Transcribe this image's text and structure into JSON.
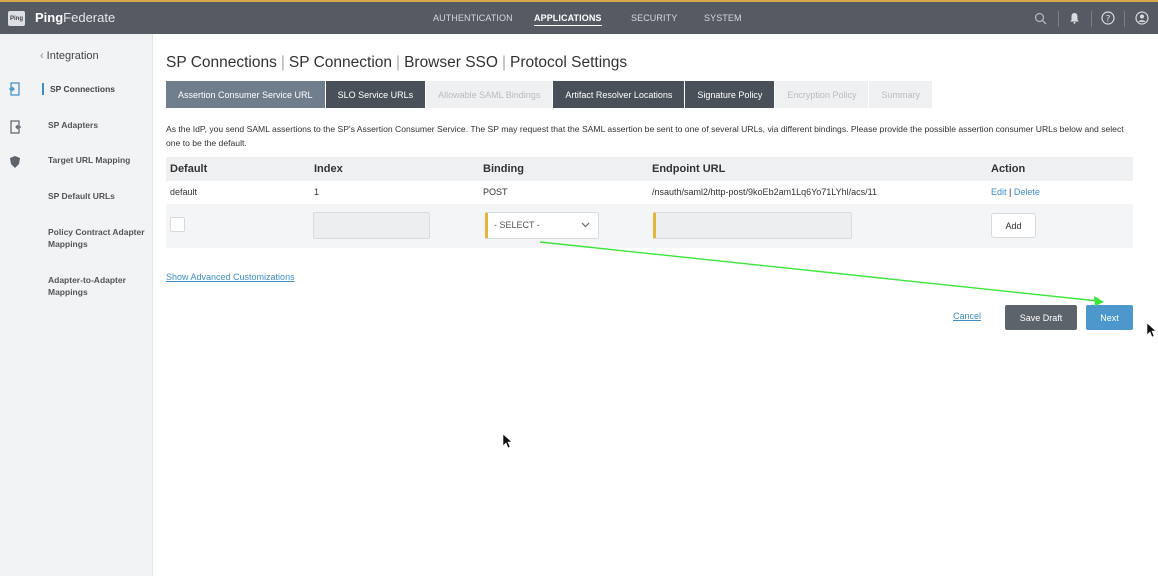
{
  "app": {
    "logo_text": "Ping",
    "brand_bold": "Ping",
    "brand_rest": "Federate"
  },
  "topnav": {
    "items": [
      {
        "label": "AUTHENTICATION",
        "active": false
      },
      {
        "label": "APPLICATIONS",
        "active": true
      },
      {
        "label": "SECURITY",
        "active": false
      },
      {
        "label": "SYSTEM",
        "active": false
      }
    ],
    "icons": [
      "search-icon",
      "bell-icon",
      "help-icon",
      "user-icon"
    ]
  },
  "sidebar": {
    "title": "Integration",
    "items": [
      {
        "label": "SP Connections",
        "active": true
      },
      {
        "label": "SP Adapters",
        "active": false
      },
      {
        "label": "Target URL Mapping",
        "active": false
      },
      {
        "label": "SP Default URLs",
        "active": false
      },
      {
        "label": "Policy Contract Adapter Mappings",
        "active": false
      },
      {
        "label": "Adapter-to-Adapter Mappings",
        "active": false
      }
    ]
  },
  "breadcrumb": [
    "SP Connections",
    "SP Connection",
    "Browser SSO",
    "Protocol Settings"
  ],
  "tabs": [
    {
      "label": "Assertion Consumer Service URL",
      "state": "current"
    },
    {
      "label": "SLO Service URLs",
      "state": "done"
    },
    {
      "label": "Allowable SAML Bindings",
      "state": "disabled"
    },
    {
      "label": "Artifact Resolver Locations",
      "state": "done"
    },
    {
      "label": "Signature Policy",
      "state": "done"
    },
    {
      "label": "Encryption Policy",
      "state": "disabled"
    },
    {
      "label": "Summary",
      "state": "disabled"
    }
  ],
  "description": "As the IdP, you send SAML assertions to the SP's Assertion Consumer Service. The SP may request that the SAML assertion be sent to one of several URLs, via different bindings. Please provide the possible assertion consumer URLs below and select one to be the default.",
  "table": {
    "headers": {
      "default": "Default",
      "index": "Index",
      "binding": "Binding",
      "endpoint": "Endpoint URL",
      "action": "Action"
    },
    "rows": [
      {
        "default": "default",
        "index": "1",
        "binding": "POST",
        "endpoint": "/nsauth/saml2/http-post/9koEb2am1Lq6Yo71LYhl/acs/11",
        "edit": "Edit",
        "delete": "Delete"
      }
    ],
    "new_row": {
      "binding_select": "- SELECT -",
      "add_label": "Add"
    }
  },
  "advanced_link": "Show Advanced Customizations",
  "footer": {
    "cancel": "Cancel",
    "save_draft": "Save Draft",
    "next": "Next"
  },
  "colors": {
    "topbar": "#565b63",
    "accent": "#4c97cc",
    "annotation_arrow": "#39e639",
    "required_marker": "#e4b53d"
  }
}
